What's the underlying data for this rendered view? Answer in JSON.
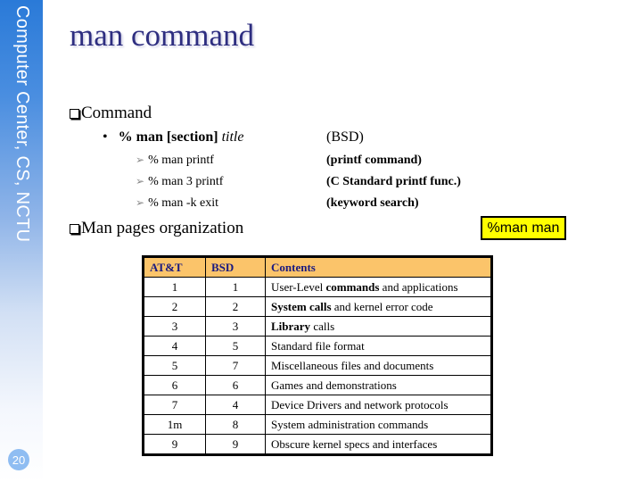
{
  "sidebar": {
    "label": "Computer Center, CS, NCTU",
    "page_number": "20"
  },
  "slide": {
    "title": "man command",
    "section1": {
      "heading": "Command",
      "syntax_prefix": "% man [section] ",
      "syntax_arg": "title",
      "syntax_note": "(BSD)",
      "examples": [
        {
          "cmd": "% man printf",
          "note": "(printf command)"
        },
        {
          "cmd": "% man 3 printf",
          "note": "(C Standard printf func.)"
        },
        {
          "cmd": "% man -k exit",
          "note": "(keyword search)"
        }
      ]
    },
    "section2": {
      "heading": "Man pages organization",
      "callout": "%man man"
    }
  },
  "table": {
    "headers": [
      "AT&T",
      "BSD",
      "Contents"
    ],
    "rows": [
      {
        "att": "1",
        "bsd": "1",
        "pre": "User-Level ",
        "bold": "commands",
        "post": " and applications"
      },
      {
        "att": "2",
        "bsd": "2",
        "pre": "",
        "bold": "System calls",
        "post": " and kernel error code"
      },
      {
        "att": "3",
        "bsd": "3",
        "pre": "",
        "bold": "Library",
        "post": " calls"
      },
      {
        "att": "4",
        "bsd": "5",
        "pre": "Standard file format",
        "bold": "",
        "post": ""
      },
      {
        "att": "5",
        "bsd": "7",
        "pre": "Miscellaneous files and documents",
        "bold": "",
        "post": ""
      },
      {
        "att": "6",
        "bsd": "6",
        "pre": "Games and demonstrations",
        "bold": "",
        "post": ""
      },
      {
        "att": "7",
        "bsd": "4",
        "pre": "Device Drivers and network protocols",
        "bold": "",
        "post": ""
      },
      {
        "att": "1m",
        "bsd": "8",
        "pre": "System administration commands",
        "bold": "",
        "post": ""
      },
      {
        "att": "9",
        "bsd": "9",
        "pre": "Obscure kernel specs and interfaces",
        "bold": "",
        "post": ""
      }
    ]
  },
  "colors": {
    "title": "#2e2e80",
    "header_bg": "#fbc46a",
    "header_text": "#1a1a80",
    "callout_bg": "#ffff00"
  }
}
